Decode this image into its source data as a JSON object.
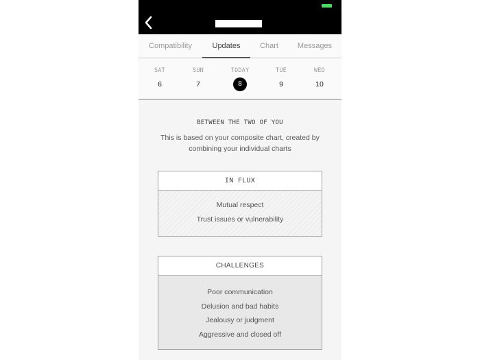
{
  "status_bar": {
    "battery_icon": "battery-icon",
    "battery_color": "#4cd964"
  },
  "header": {
    "back_icon": "chevron-left-icon",
    "title_redacted": true
  },
  "tabs": [
    {
      "label": "Compatibility",
      "active": false
    },
    {
      "label": "Updates",
      "active": true
    },
    {
      "label": "Chart",
      "active": false
    },
    {
      "label": "Messages",
      "active": false
    }
  ],
  "days": [
    {
      "name": "SAT",
      "number": "6",
      "selected": false
    },
    {
      "name": "SUN",
      "number": "7",
      "selected": false
    },
    {
      "name": "TODAY",
      "number": "8",
      "selected": true
    },
    {
      "name": "TUE",
      "number": "9",
      "selected": false
    },
    {
      "name": "WED",
      "number": "10",
      "selected": false
    }
  ],
  "section": {
    "title": "BETWEEN THE TWO OF YOU",
    "description": "This is based on your composite chart, created by combining your individual charts"
  },
  "cards": {
    "in_flux": {
      "header": "IN FLUX",
      "items": [
        "Mutual respect",
        "Trust issues or vulnerability"
      ]
    },
    "challenges": {
      "header": "CHALLENGES",
      "items": [
        "Poor communication",
        "Delusion and bad habits",
        "Jealousy or judgment",
        "Aggressive and closed off"
      ]
    }
  }
}
